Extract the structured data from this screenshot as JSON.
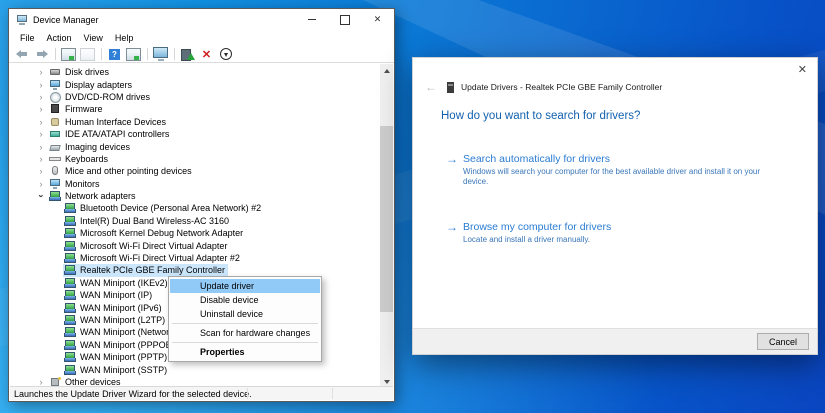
{
  "colors": {
    "wallpaper_blue_light": "#2aa2ea",
    "wallpaper_blue_dark": "#0a45c0",
    "menu_highlight": "#91c9f7",
    "tree_selection": "#cbe6fb",
    "heading_blue": "#1261ae",
    "link_blue": "#2b7cd4"
  },
  "device_manager": {
    "title": "Device Manager",
    "menu_items": [
      {
        "label": "File"
      },
      {
        "label": "Action"
      },
      {
        "label": "View"
      },
      {
        "label": "Help"
      }
    ],
    "toolbar": [
      {
        "name": "back-icon",
        "type": "back"
      },
      {
        "name": "forward-icon",
        "type": "forward"
      },
      {
        "name": "toolbar-separator",
        "type": "sep"
      },
      {
        "name": "show-console-tree-icon",
        "type": "console"
      },
      {
        "name": "export-list-icon",
        "type": "export"
      },
      {
        "name": "toolbar-separator",
        "type": "sep"
      },
      {
        "name": "help-icon",
        "type": "help"
      },
      {
        "name": "properties-window-icon",
        "type": "winprop"
      },
      {
        "name": "toolbar-separator",
        "type": "sep"
      },
      {
        "name": "computer-icon",
        "type": "computer"
      },
      {
        "name": "toolbar-separator",
        "type": "sep"
      },
      {
        "name": "update-driver-icon",
        "type": "updatedrv"
      },
      {
        "name": "uninstall-device-icon",
        "type": "uninstall"
      },
      {
        "name": "scan-hardware-changes-icon",
        "type": "scan"
      }
    ],
    "tree": {
      "items": [
        {
          "label": "Disk drives",
          "level": 1,
          "expander": "collapsed",
          "icon": "disk"
        },
        {
          "label": "Display adapters",
          "level": 1,
          "expander": "collapsed",
          "icon": "display"
        },
        {
          "label": "DVD/CD-ROM drives",
          "level": 1,
          "expander": "collapsed",
          "icon": "dvd"
        },
        {
          "label": "Firmware",
          "level": 1,
          "expander": "collapsed",
          "icon": "firmware"
        },
        {
          "label": "Human Interface Devices",
          "level": 1,
          "expander": "collapsed",
          "icon": "hid"
        },
        {
          "label": "IDE ATA/ATAPI controllers",
          "level": 1,
          "expander": "collapsed",
          "icon": "ide"
        },
        {
          "label": "Imaging devices",
          "level": 1,
          "expander": "collapsed",
          "icon": "imaging"
        },
        {
          "label": "Keyboards",
          "level": 1,
          "expander": "collapsed",
          "icon": "keyboard"
        },
        {
          "label": "Mice and other pointing devices",
          "level": 1,
          "expander": "collapsed",
          "icon": "mouse"
        },
        {
          "label": "Monitors",
          "level": 1,
          "expander": "collapsed",
          "icon": "monitor"
        },
        {
          "label": "Network adapters",
          "level": 1,
          "expander": "expanded",
          "icon": "network"
        },
        {
          "label": "Bluetooth Device (Personal Area Network) #2",
          "level": 2,
          "expander": "none",
          "icon": "network"
        },
        {
          "label": "Intel(R) Dual Band Wireless-AC 3160",
          "level": 2,
          "expander": "none",
          "icon": "network"
        },
        {
          "label": "Microsoft Kernel Debug Network Adapter",
          "level": 2,
          "expander": "none",
          "icon": "network"
        },
        {
          "label": "Microsoft Wi-Fi Direct Virtual Adapter",
          "level": 2,
          "expander": "none",
          "icon": "network"
        },
        {
          "label": "Microsoft Wi-Fi Direct Virtual Adapter #2",
          "level": 2,
          "expander": "none",
          "icon": "network"
        },
        {
          "label": "Realtek PCIe GBE Family Controller",
          "level": 2,
          "expander": "none",
          "icon": "network",
          "selected": true
        },
        {
          "label": "WAN Miniport (IKEv2)",
          "level": 2,
          "expander": "none",
          "icon": "network"
        },
        {
          "label": "WAN Miniport (IP)",
          "level": 2,
          "expander": "none",
          "icon": "network"
        },
        {
          "label": "WAN Miniport (IPv6)",
          "level": 2,
          "expander": "none",
          "icon": "network"
        },
        {
          "label": "WAN Miniport (L2TP)",
          "level": 2,
          "expander": "none",
          "icon": "network"
        },
        {
          "label": "WAN Miniport (Network Monitor)",
          "level": 2,
          "expander": "none",
          "icon": "network"
        },
        {
          "label": "WAN Miniport (PPPOE)",
          "level": 2,
          "expander": "none",
          "icon": "network"
        },
        {
          "label": "WAN Miniport (PPTP)",
          "level": 2,
          "expander": "none",
          "icon": "network"
        },
        {
          "label": "WAN Miniport (SSTP)",
          "level": 2,
          "expander": "none",
          "icon": "network"
        },
        {
          "label": "Other devices",
          "level": 1,
          "expander": "collapsed",
          "icon": "other"
        }
      ]
    },
    "status_text": "Launches the Update Driver Wizard for the selected device."
  },
  "context_menu": {
    "items": [
      {
        "label": "Update driver",
        "highlighted": true
      },
      {
        "label": "Disable device"
      },
      {
        "label": "Uninstall device"
      },
      {
        "separator": true
      },
      {
        "label": "Scan for hardware changes"
      },
      {
        "separator": true
      },
      {
        "label": "Properties",
        "bold": true
      }
    ]
  },
  "update_dialog": {
    "title": "Update Drivers - Realtek PCIe GBE Family Controller",
    "heading": "How do you want to search for drivers?",
    "options": [
      {
        "title": "Search automatically for drivers",
        "description": "Windows will search your computer for the best available driver and install it on your device."
      },
      {
        "title": "Browse my computer for drivers",
        "description": "Locate and install a driver manually."
      }
    ],
    "cancel_label": "Cancel"
  }
}
